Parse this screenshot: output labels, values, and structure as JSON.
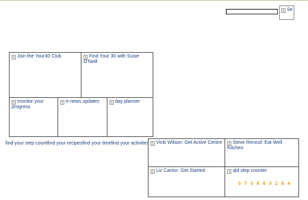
{
  "search": {
    "button_label": "Se"
  },
  "tiles_top": [
    {
      "label": "Join the Your30 Club"
    },
    {
      "label": "Find Your 30 with Susie O'Neill"
    }
  ],
  "tiles_mid": [
    {
      "label": "monitor your progress"
    },
    {
      "label": "e-news updates"
    },
    {
      "label": "day planner"
    }
  ],
  "links": [
    "find your step count",
    "find your recipes",
    "find your time",
    "find your activities"
  ],
  "tiles_bottom": [
    {
      "label": "Vicki Wilson: Get Active Centre"
    },
    {
      "label": "Steve Renouf: Eat Well Kitchen"
    },
    {
      "label": "Liz Cantor: Get Started"
    },
    {
      "label": "qld step counter"
    }
  ],
  "step_counter": {
    "digits": [
      "0",
      "7",
      "5",
      "6",
      "6",
      "5",
      "2",
      "8",
      "4"
    ],
    "color": "#e8a01e"
  }
}
